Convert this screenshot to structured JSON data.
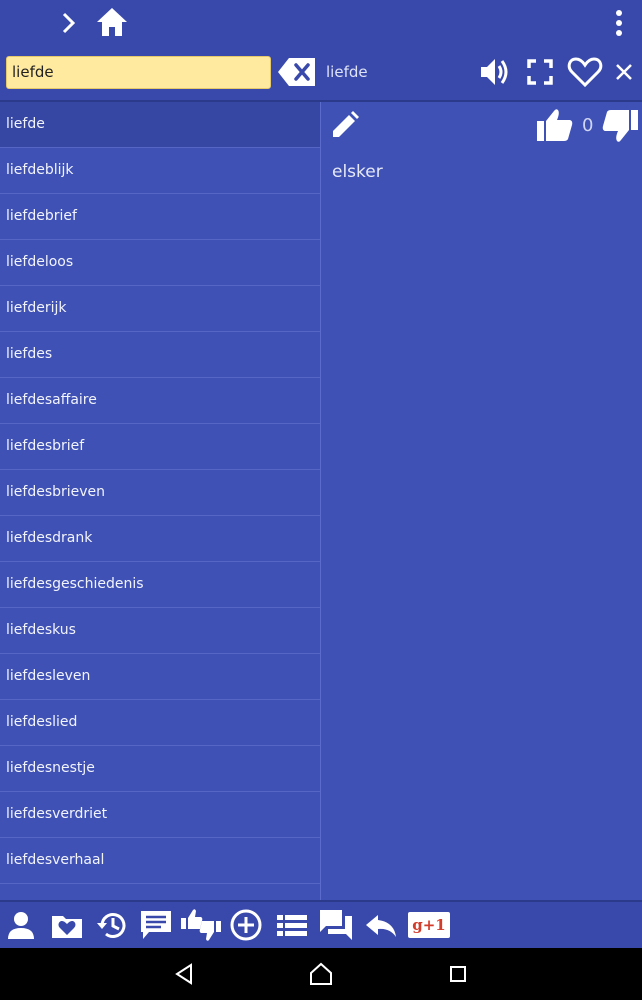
{
  "search": {
    "value": "liefde"
  },
  "header": {
    "word": "liefde"
  },
  "list": {
    "items": [
      "liefde",
      "liefdeblijk",
      "liefdebrief",
      "liefdeloos",
      "liefderijk",
      "liefdes",
      "liefdesaffaire",
      "liefdesbrief",
      "liefdesbrieven",
      "liefdesdrank",
      "liefdesgeschiedenis",
      "liefdeskus",
      "liefdesleven",
      "liefdeslied",
      "liefdesnestje",
      "liefdesverdriet",
      "liefdesverhaal"
    ],
    "selected_index": 0
  },
  "detail": {
    "like_count": "0",
    "translation": "elsker"
  },
  "bottom": {
    "gplus_label": "g+1"
  },
  "icons": {
    "top": [
      "chevron-right-icon",
      "home-icon",
      "more-vert-icon"
    ],
    "toolbar": [
      "backspace-clear-icon",
      "volume-icon",
      "fullscreen-icon",
      "heart-icon",
      "close-icon"
    ],
    "detail": [
      "edit-icon",
      "thumb-up-icon",
      "thumb-down-icon"
    ],
    "bottom": [
      "person-icon",
      "folder-heart-icon",
      "history-icon",
      "comment-icon",
      "thumbs-up-down-icon",
      "add-circle-icon",
      "list-icon",
      "forum-icon",
      "reply-icon",
      "google-plus-one-icon"
    ],
    "nav": [
      "back-icon",
      "home-nav-icon",
      "recents-icon"
    ]
  },
  "colors": {
    "primary": "#3f51b5",
    "primary_dark": "#3949ab",
    "search_bg": "#ffeaa0",
    "gplus_red": "#d23c2b"
  }
}
